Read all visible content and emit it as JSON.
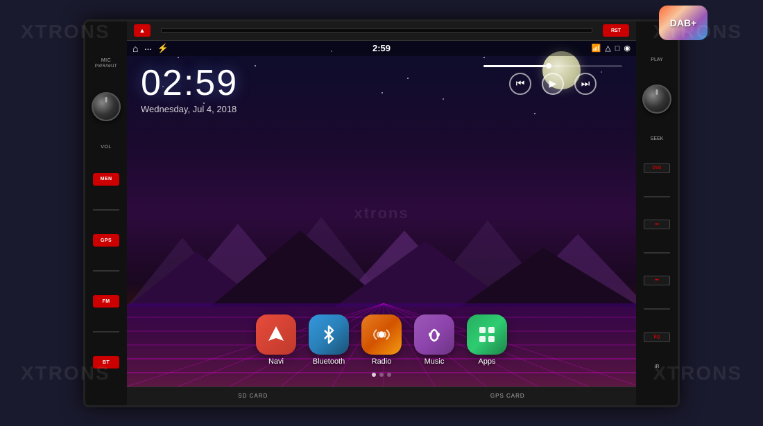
{
  "brand": "XTRONS",
  "dab_badge": "DAB+",
  "unit": {
    "top_buttons": {
      "eject_label": "▲",
      "rst_label": "RST"
    },
    "left_controls": {
      "mic_label": "MIC",
      "pwr_mut_label": "PWR/MUT",
      "vol_label": "VOL",
      "buttons": [
        {
          "id": "men",
          "label": "MEN"
        },
        {
          "id": "gps",
          "label": "GPS"
        },
        {
          "id": "fm",
          "label": "FM"
        },
        {
          "id": "bt",
          "label": "BT"
        }
      ]
    },
    "right_controls": {
      "rst_label": "RST",
      "play_label": "PLAY",
      "seek_label": "SEEK",
      "buttons": [
        {
          "id": "dvd",
          "label": "DVD"
        },
        {
          "id": "next",
          "label": "⏭"
        },
        {
          "id": "prev",
          "label": "⏮"
        },
        {
          "id": "eq",
          "label": "EQ"
        },
        {
          "id": "ir",
          "label": "IR"
        }
      ]
    },
    "bottom_buttons": [
      {
        "id": "sd-card",
        "label": "SD CARD"
      },
      {
        "id": "gps-card",
        "label": "GPS CARD"
      }
    ]
  },
  "screen": {
    "status_bar": {
      "time": "2:59",
      "icons": [
        "wifi",
        "triangle",
        "square",
        "android"
      ]
    },
    "clock": {
      "time": "02:59",
      "date": "Wednesday, Jul 4, 2018"
    },
    "apps": [
      {
        "id": "navi",
        "label": "Navi",
        "icon": "navi"
      },
      {
        "id": "bluetooth",
        "label": "Bluetooth",
        "icon": "bluetooth"
      },
      {
        "id": "radio",
        "label": "Radio",
        "icon": "radio"
      },
      {
        "id": "music",
        "label": "Music",
        "icon": "music"
      },
      {
        "id": "apps",
        "label": "Apps",
        "icon": "apps"
      }
    ],
    "dots": [
      {
        "active": true
      },
      {
        "active": false
      },
      {
        "active": false
      }
    ]
  }
}
